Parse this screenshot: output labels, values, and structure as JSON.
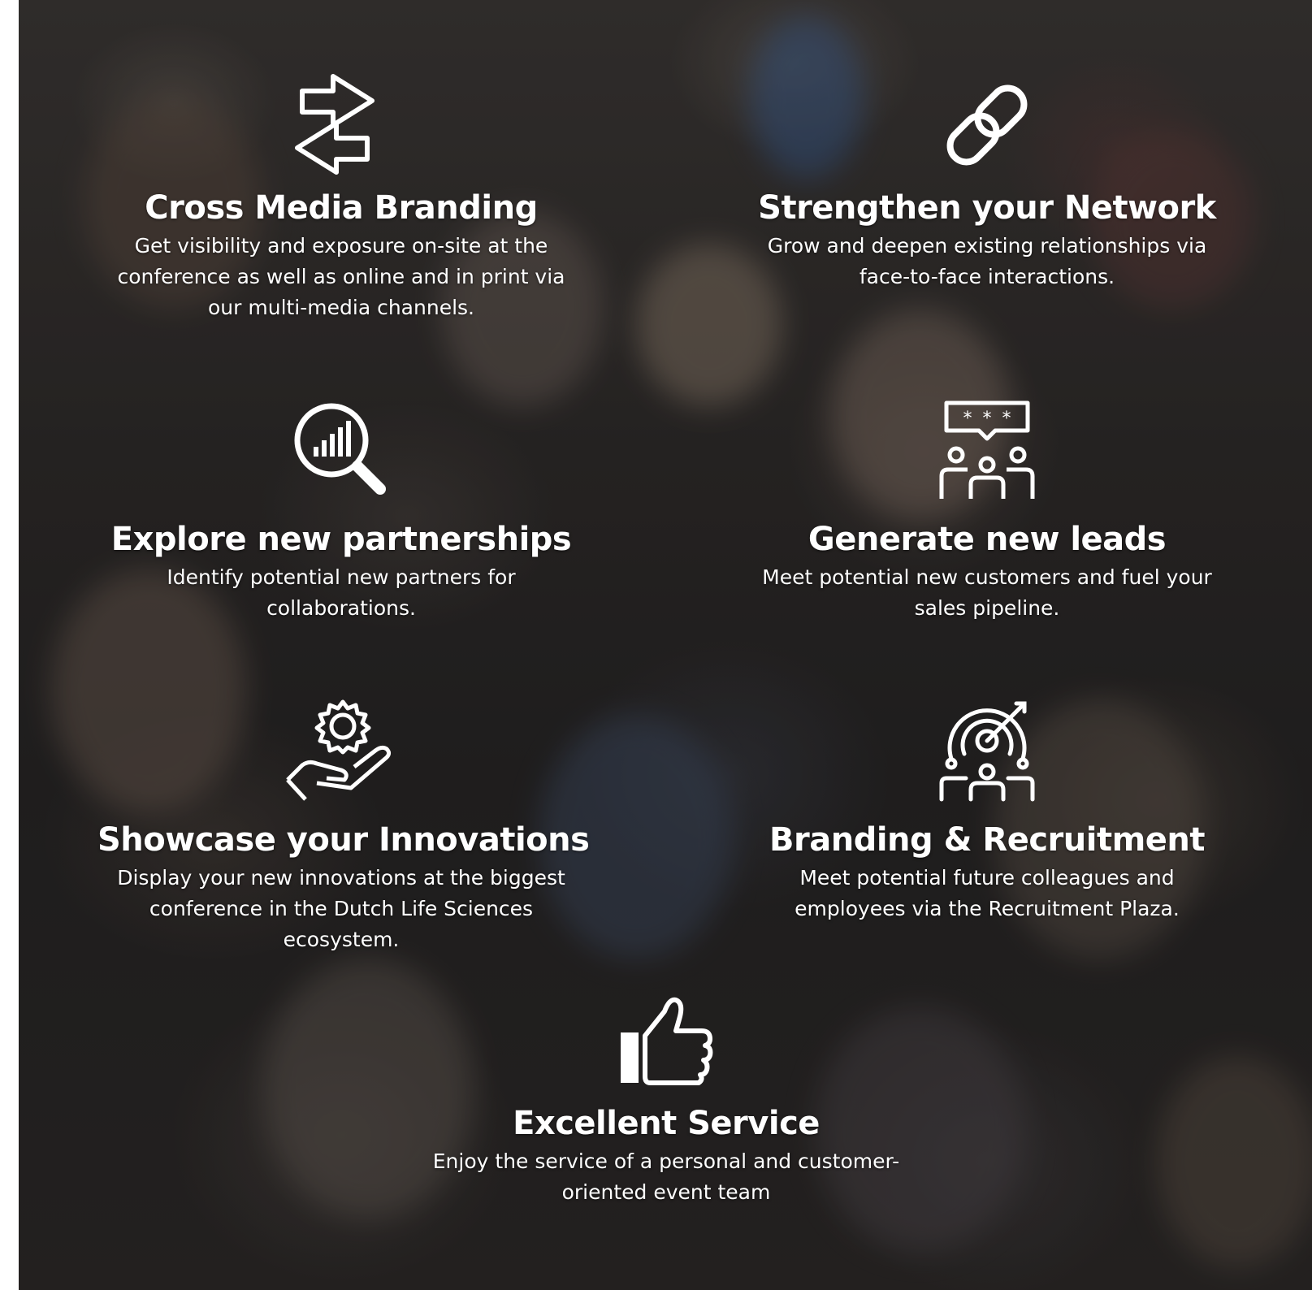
{
  "colors": {
    "text": "#ffffff",
    "overlay": "#2b2827",
    "page_bg": "#ffffff"
  },
  "features": [
    {
      "icon": "arrows-exchange-icon",
      "title": "Cross Media Branding",
      "description": "Get visibility and exposure on-site at the conference as well as online and in print via our multi-media channels."
    },
    {
      "icon": "chain-link-icon",
      "title": "Strengthen your Network",
      "description": "Grow and deepen existing relationships via face-to-face interactions."
    },
    {
      "icon": "magnifier-chart-icon",
      "title": "Explore new partnerships",
      "description": "Identify potential new partners for collaborations."
    },
    {
      "icon": "group-review-icon",
      "title": "Generate new leads",
      "description": "Meet potential new customers and fuel your sales pipeline."
    },
    {
      "icon": "gear-hand-icon",
      "title": "Showcase your Innovations",
      "description": "Display your new innovations at the biggest conference in the Dutch Life Sciences ecosystem."
    },
    {
      "icon": "target-people-icon",
      "title": "Branding & Recruitment",
      "description": "Meet potential future colleagues and employees via the Recruitment Plaza."
    },
    {
      "icon": "thumbs-up-icon",
      "title": "Excellent Service",
      "description": "Enjoy the service of a personal and customer-oriented event team"
    }
  ]
}
